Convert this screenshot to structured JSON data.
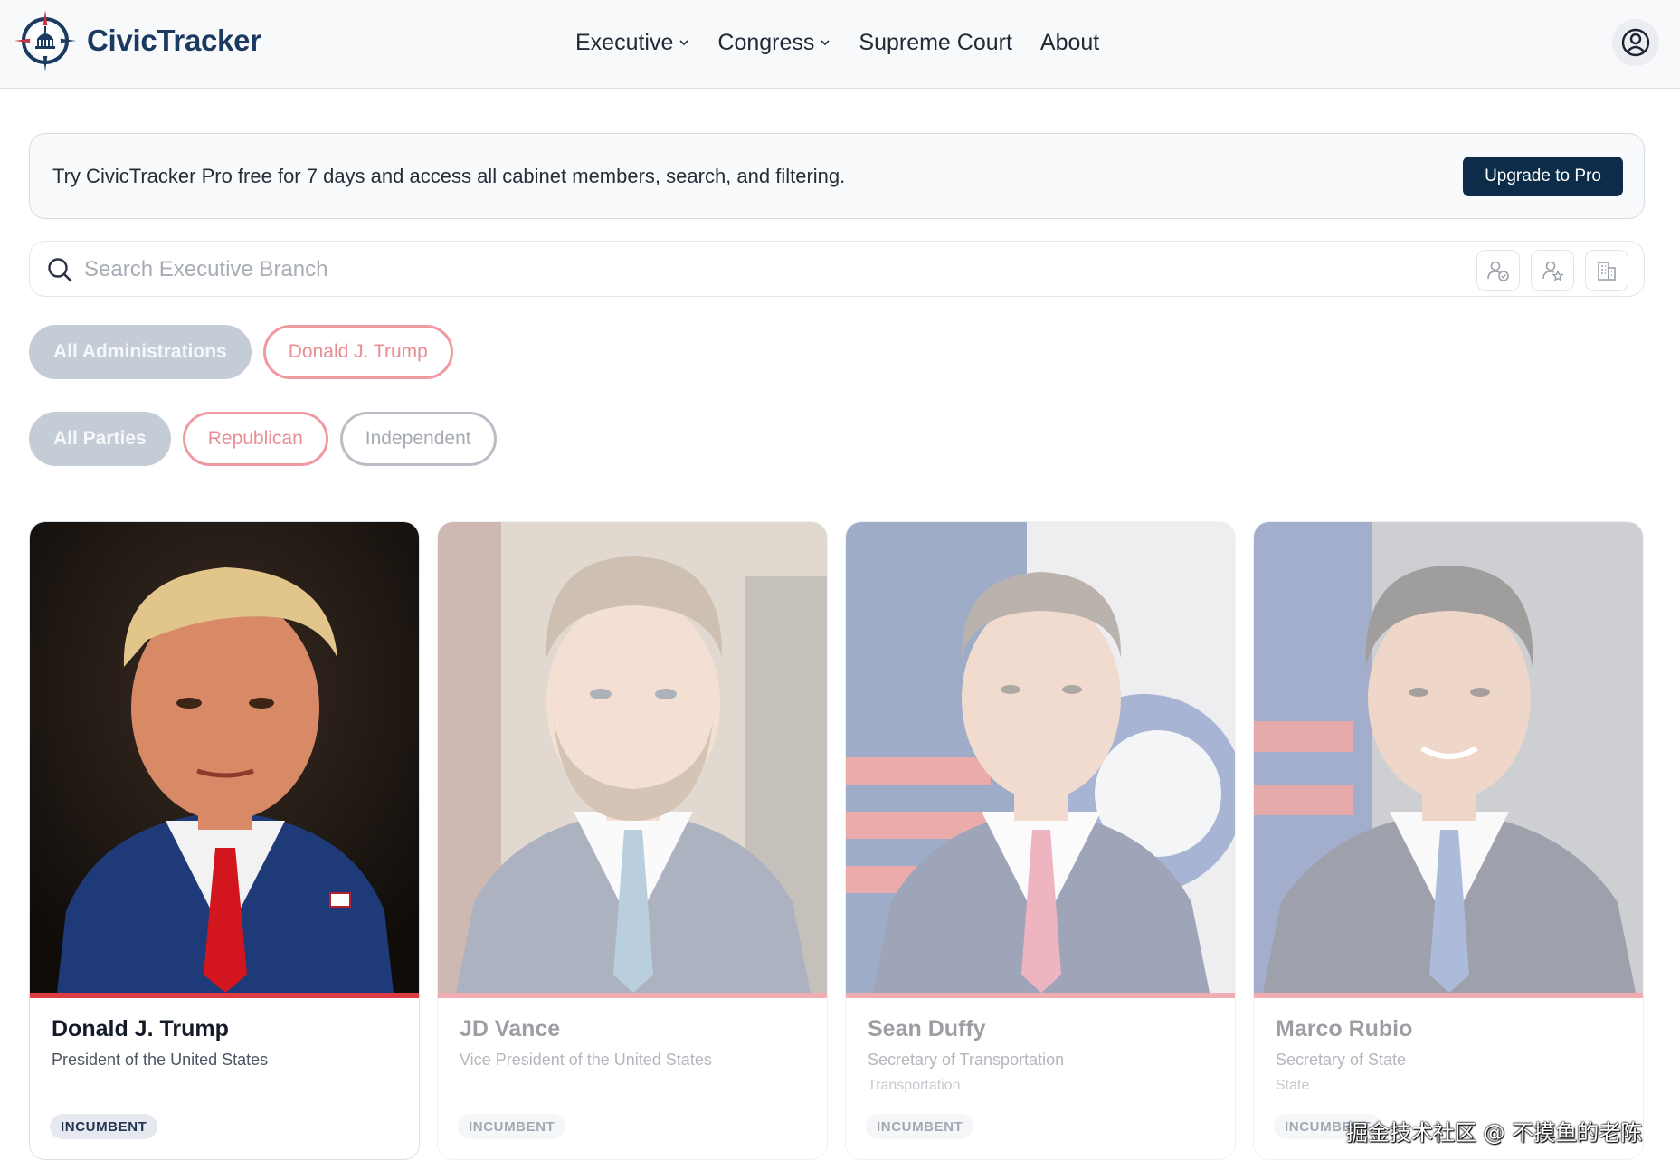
{
  "app": {
    "brand": "CivicTracker"
  },
  "nav": {
    "items": [
      {
        "label": "Executive",
        "has_dropdown": true
      },
      {
        "label": "Congress",
        "has_dropdown": true
      },
      {
        "label": "Supreme Court",
        "has_dropdown": false
      },
      {
        "label": "About",
        "has_dropdown": false
      }
    ]
  },
  "promo": {
    "text": "Try CivicTracker Pro free for 7 days and access all cabinet members, search, and filtering.",
    "button_label": "Upgrade to Pro"
  },
  "search": {
    "placeholder": "Search Executive Branch",
    "value": "",
    "tools": [
      "person-check-icon",
      "person-star-icon",
      "building-icon"
    ]
  },
  "filters": {
    "administrations": [
      {
        "label": "All Administrations",
        "state": "active"
      },
      {
        "label": "Donald J. Trump",
        "state": "red"
      }
    ],
    "parties": [
      {
        "label": "All Parties",
        "state": "active"
      },
      {
        "label": "Republican",
        "state": "red"
      },
      {
        "label": "Independent",
        "state": "gray"
      }
    ]
  },
  "cards": [
    {
      "name": "Donald J. Trump",
      "title": "President of the United States",
      "department": "",
      "badge": "INCUMBENT",
      "dimmed": false
    },
    {
      "name": "JD Vance",
      "title": "Vice President of the United States",
      "department": "",
      "badge": "INCUMBENT",
      "dimmed": true
    },
    {
      "name": "Sean Duffy",
      "title": "Secretary of Transportation",
      "department": "Transportation",
      "badge": "INCUMBENT",
      "dimmed": true
    },
    {
      "name": "Marco Rubio",
      "title": "Secretary of State",
      "department": "State",
      "badge": "INCUMBENT",
      "dimmed": true
    }
  ],
  "colors": {
    "brand_navy": "#1c3a60",
    "button_navy": "#0c2c49",
    "party_red": "#dd3c44",
    "chip_active": "#c4ccd6"
  },
  "watermark": "掘金技术社区 @ 不摸鱼的老陈"
}
